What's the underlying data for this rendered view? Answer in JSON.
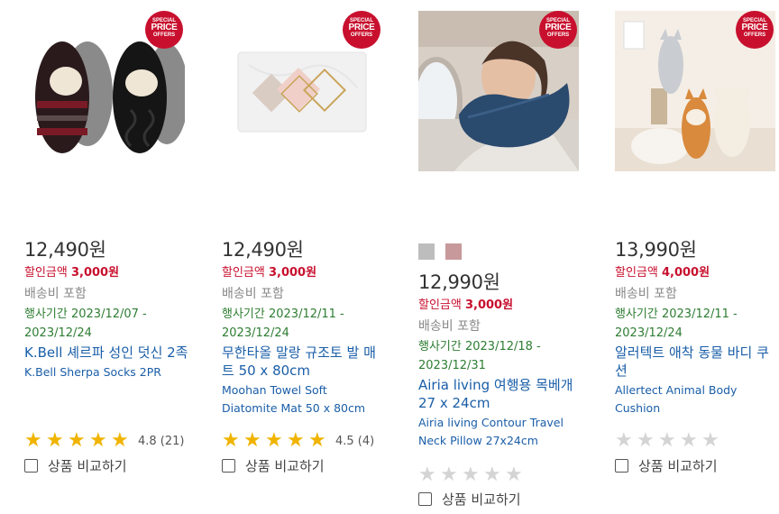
{
  "badge": {
    "line1": "SPECIAL",
    "line2a": "PRICE",
    "line2b": "",
    "line3": "OFFERS"
  },
  "compare_label": "상품 비교하기",
  "products": [
    {
      "price": "12,490원",
      "discount_label": "할인금액",
      "discount_amount": "3,000원",
      "shipping": "배송비 포함",
      "period_label": "행사기간",
      "period": "2023/12/07 - 2023/12/24",
      "name_ko": "K.Bell 셰르파 성인 덧신 2족",
      "name_en": "K.Bell Sherpa Socks 2PR",
      "rating": 4.8,
      "stars_filled": 5,
      "rating_text": "4.8 (21)"
    },
    {
      "price": "12,490원",
      "discount_label": "할인금액",
      "discount_amount": "3,000원",
      "shipping": "배송비 포함",
      "period_label": "행사기간",
      "period": "2023/12/11 - 2023/12/24",
      "name_ko": "무한타올 말랑 규조토 발 매트 50 x 80cm",
      "name_en": "Moohan Towel Soft Diatomite Mat 50 x 80cm",
      "rating": 4.5,
      "stars_filled": 5,
      "rating_text": "4.5 (4)"
    },
    {
      "price": "12,990원",
      "discount_label": "할인금액",
      "discount_amount": "3,000원",
      "shipping": "배송비 포함",
      "period_label": "행사기간",
      "period": "2023/12/18 - 2023/12/31",
      "name_ko": "Airia living 여행용 목베개 27 x 24cm",
      "name_en": "Airia living Contour Travel Neck Pillow 27x24cm",
      "rating": 0,
      "stars_filled": 0,
      "rating_text": "",
      "swatches": [
        "#bdbdbd",
        "#c7999b"
      ]
    },
    {
      "price": "13,990원",
      "discount_label": "할인금액",
      "discount_amount": "4,000원",
      "shipping": "배송비 포함",
      "period_label": "행사기간",
      "period": "2023/12/11 - 2023/12/24",
      "name_ko": "알러텍트 애착 동물 바디 쿠션",
      "name_en": "Allertect Animal Body Cushion",
      "rating": 0,
      "stars_filled": 0,
      "rating_text": ""
    }
  ],
  "colors": {
    "discount": "#c8102e",
    "period": "#2e7d32",
    "link": "#1a5ea8",
    "star_on": "#f0b400",
    "star_off": "#d4d4d4",
    "badge": "#c8102e"
  }
}
